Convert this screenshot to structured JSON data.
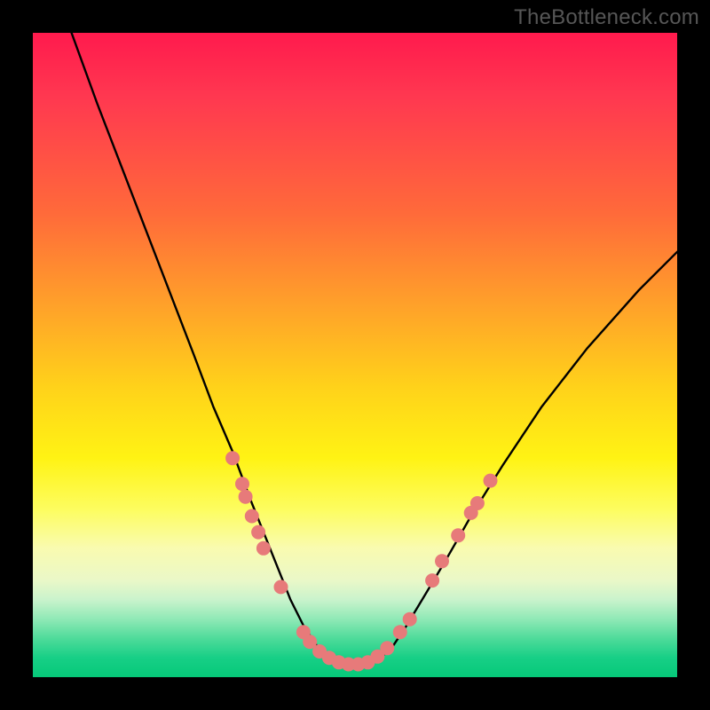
{
  "watermark": "TheBottleneck.com",
  "colors": {
    "curve": "#000000",
    "marker_fill": "#e77a7a",
    "marker_stroke": "#cc5a5a"
  },
  "chart_data": {
    "type": "line",
    "title": "",
    "xlabel": "",
    "ylabel": "",
    "xlim": [
      0,
      100
    ],
    "ylim": [
      0,
      100
    ],
    "grid": false,
    "legend": false,
    "annotations": [],
    "series": [
      {
        "name": "bottleneck-curve",
        "x": [
          6,
          10,
          15,
          20,
          25,
          28,
          31,
          34,
          36,
          38,
          40,
          42,
          44,
          46,
          48,
          50,
          52,
          54,
          56,
          58,
          61,
          64,
          68,
          73,
          79,
          86,
          94,
          100
        ],
        "y": [
          100,
          89,
          76,
          63,
          50,
          42,
          35,
          27,
          22,
          17,
          12,
          8,
          5,
          3,
          2,
          2,
          2,
          3,
          5,
          8,
          13,
          18,
          25,
          33,
          42,
          51,
          60,
          66
        ]
      }
    ],
    "markers": [
      {
        "x": 31.0,
        "y": 34
      },
      {
        "x": 32.5,
        "y": 30
      },
      {
        "x": 33.0,
        "y": 28
      },
      {
        "x": 34.0,
        "y": 25
      },
      {
        "x": 35.0,
        "y": 22.5
      },
      {
        "x": 35.8,
        "y": 20
      },
      {
        "x": 38.5,
        "y": 14
      },
      {
        "x": 42.0,
        "y": 7
      },
      {
        "x": 43.0,
        "y": 5.5
      },
      {
        "x": 44.5,
        "y": 4
      },
      {
        "x": 46.0,
        "y": 3
      },
      {
        "x": 47.5,
        "y": 2.3
      },
      {
        "x": 49.0,
        "y": 2
      },
      {
        "x": 50.5,
        "y": 2
      },
      {
        "x": 52.0,
        "y": 2.3
      },
      {
        "x": 53.5,
        "y": 3.2
      },
      {
        "x": 55.0,
        "y": 4.5
      },
      {
        "x": 57.0,
        "y": 7
      },
      {
        "x": 58.5,
        "y": 9
      },
      {
        "x": 62.0,
        "y": 15
      },
      {
        "x": 63.5,
        "y": 18
      },
      {
        "x": 66.0,
        "y": 22
      },
      {
        "x": 68.0,
        "y": 25.5
      },
      {
        "x": 69.0,
        "y": 27
      },
      {
        "x": 71.0,
        "y": 30.5
      }
    ],
    "marker_radius_px": 8
  }
}
